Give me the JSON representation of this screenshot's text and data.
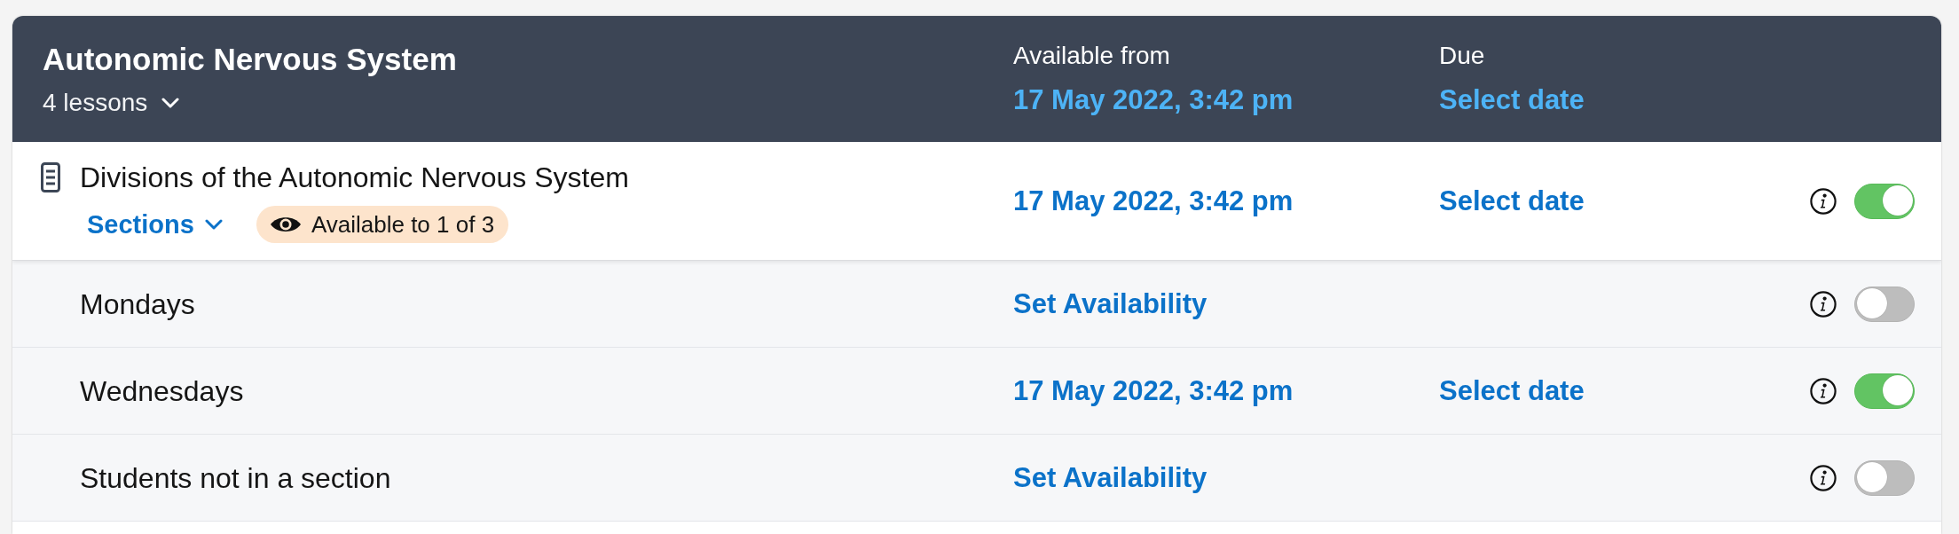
{
  "header": {
    "title": "Autonomic Nervous System",
    "lessons": "4 lessons",
    "available_from_label": "Available from",
    "available_from": "17 May 2022, 3:42 pm",
    "due_label": "Due",
    "due": "Select date"
  },
  "lesson": {
    "title": "Divisions of the Autonomic Nervous System",
    "sections_link": "Sections",
    "badge": "Available to 1 of 3",
    "available_from": "17 May 2022, 3:42 pm",
    "due": "Select date",
    "on": true
  },
  "sections": [
    {
      "name": "Mondays",
      "available_from": "Set Availability",
      "on": false
    },
    {
      "name": "Wednesdays",
      "available_from": "17 May 2022, 3:42 pm",
      "due": "Select date",
      "on": true
    },
    {
      "name": "Students not in a section",
      "available_from": "Set Availability",
      "on": false
    }
  ]
}
